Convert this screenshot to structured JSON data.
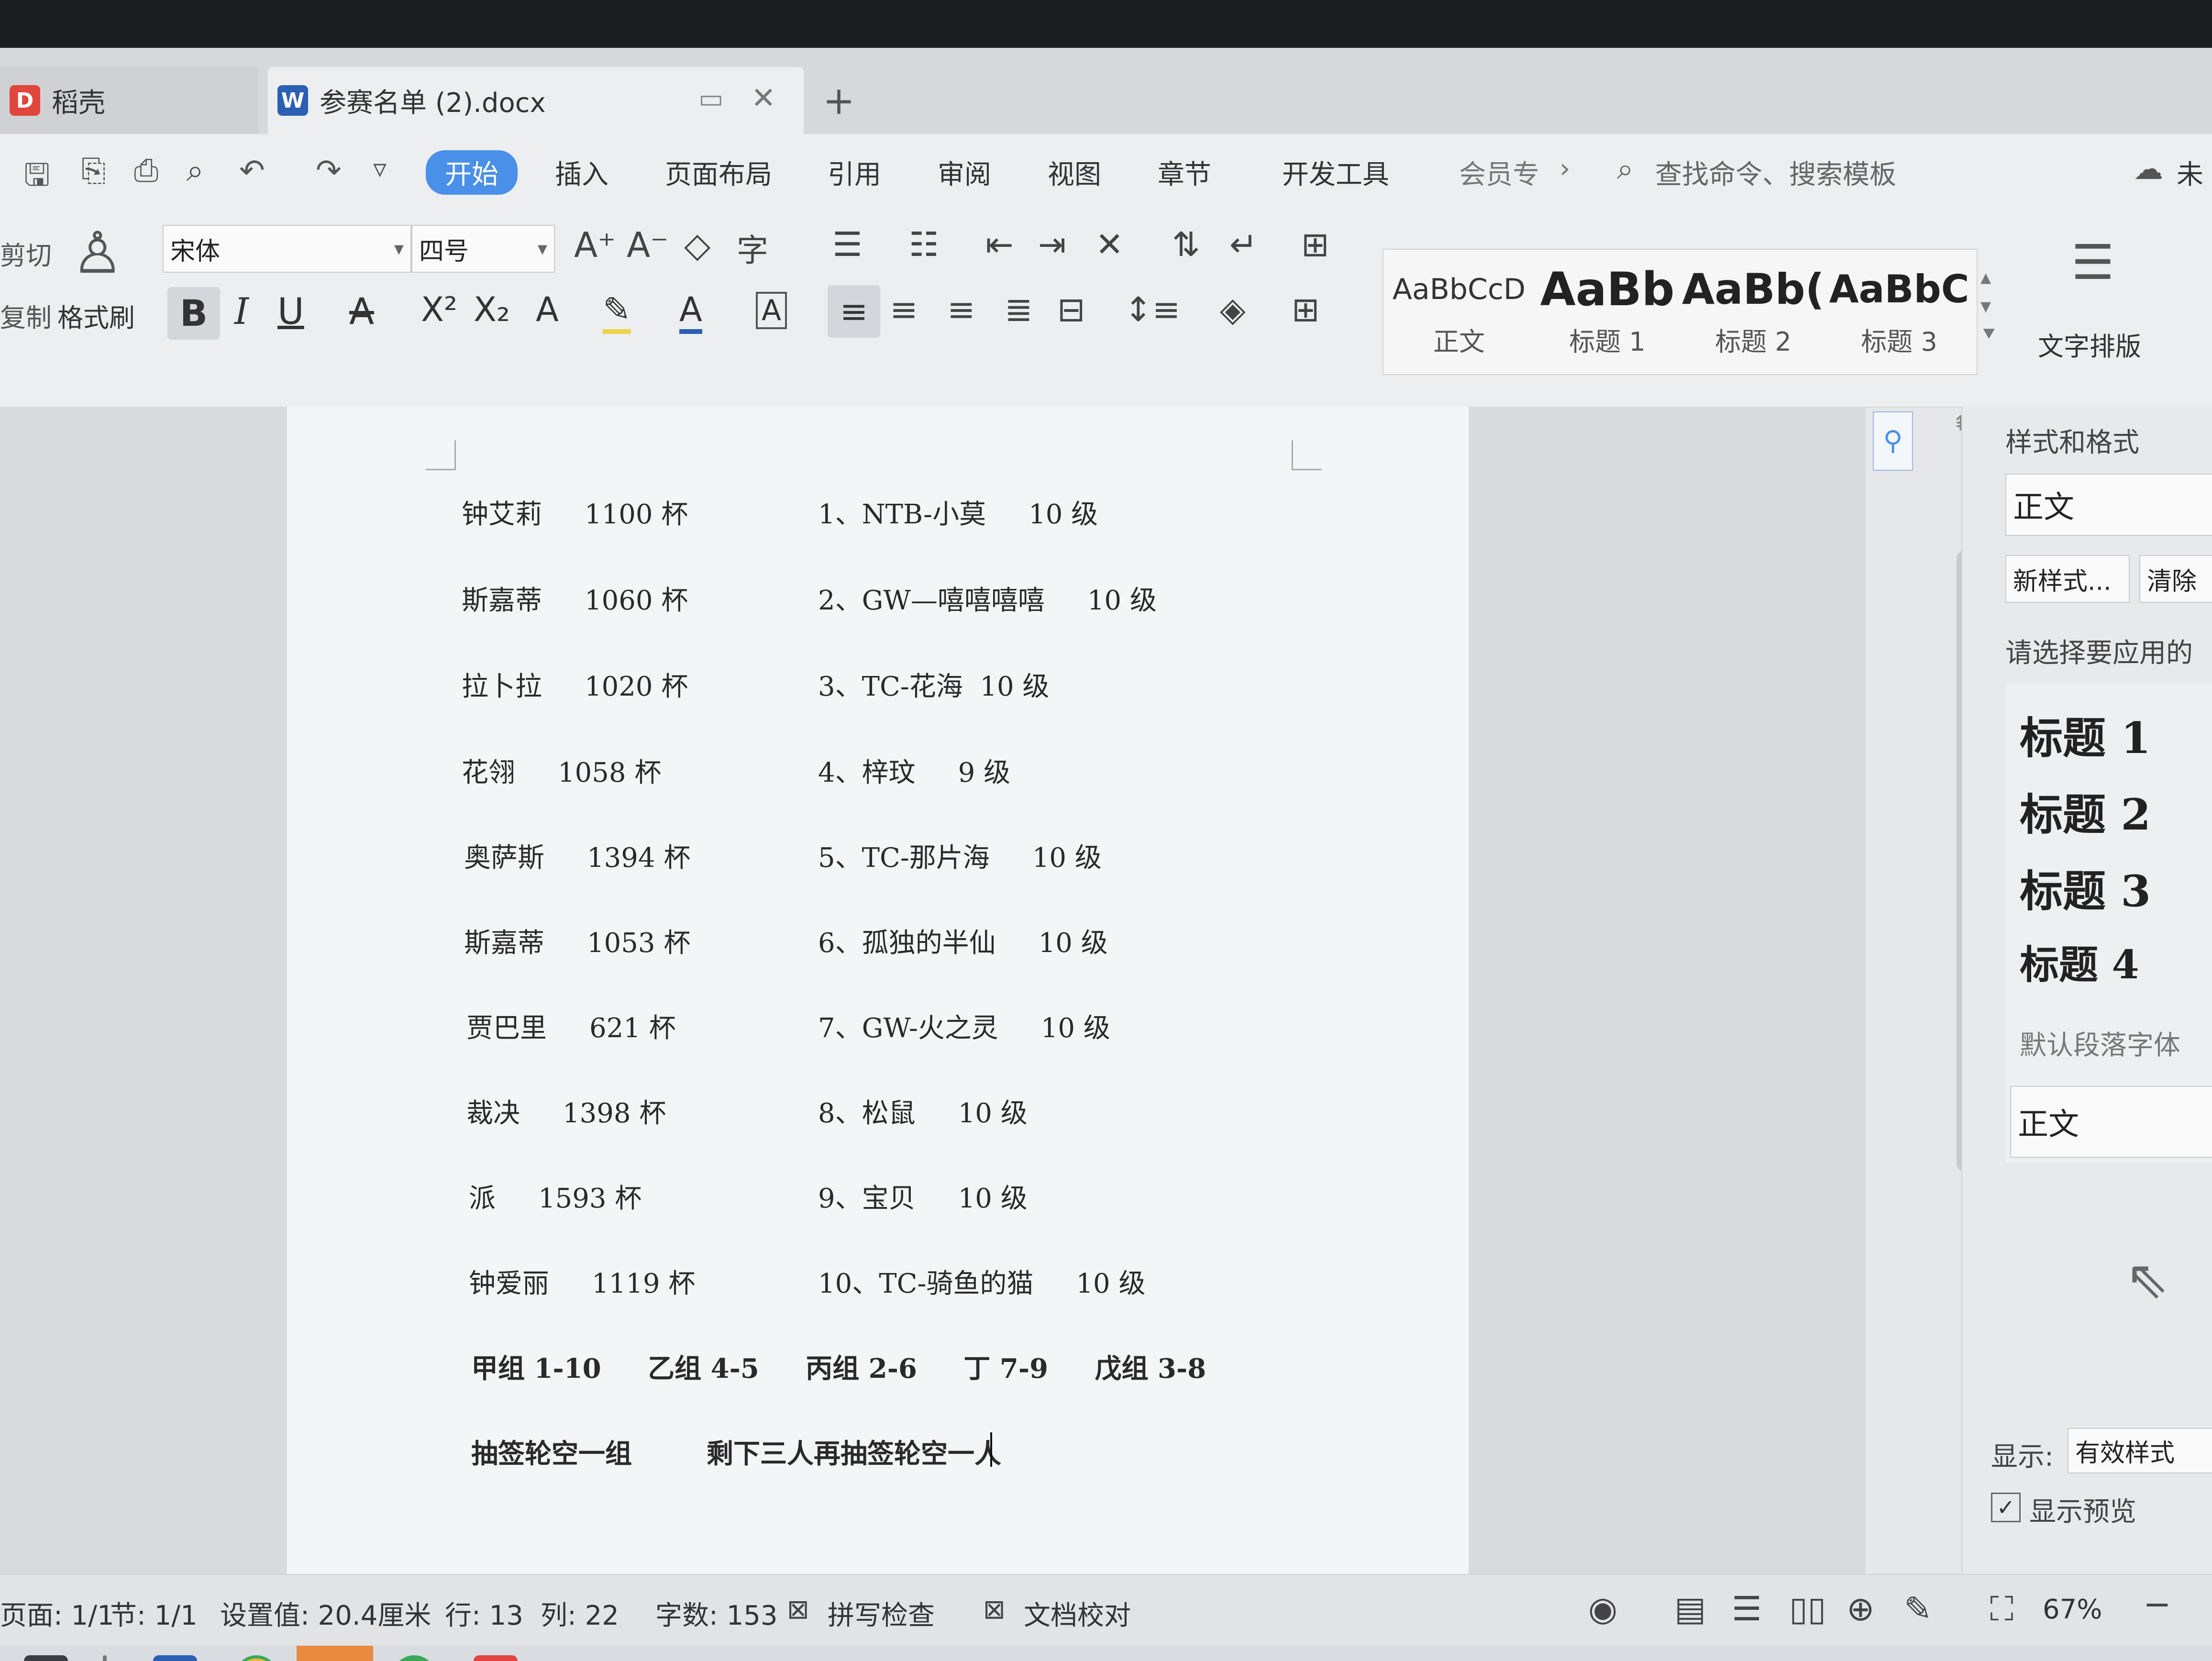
{
  "tabs": {
    "app_tab": "稻壳",
    "doc_tab": "参赛名单 (2).docx",
    "new_tab": "+"
  },
  "menu": {
    "items": [
      "开始",
      "插入",
      "页面布局",
      "引用",
      "审阅",
      "视图",
      "章节",
      "开发工具",
      "会员专"
    ],
    "more": "›",
    "search_placeholder": "查找命令、搜索模板",
    "cloud": "未"
  },
  "ribbon": {
    "cut": "剪切",
    "copy": "复制",
    "format_painter": "格式刷",
    "font_name": "宋体",
    "font_size": "四号",
    "styles": [
      {
        "preview": "AaBbCcD",
        "label": "正文"
      },
      {
        "preview": "AaBb",
        "label": "标题 1"
      },
      {
        "preview": "AaBb(",
        "label": "标题 2"
      },
      {
        "preview": "AaBbC",
        "label": "标题 3"
      }
    ],
    "text_layout": "文字排版"
  },
  "document": {
    "rows": [
      {
        "left": "钟艾莉     1100 杯",
        "right": "1、NTB-小莫     10 级"
      },
      {
        "left": "斯嘉蒂     1060 杯",
        "right": "2、GW—嘻嘻嘻嘻     10 级"
      },
      {
        "left": "拉卜拉     1020 杯",
        "right": "3、TC-花海  10 级"
      },
      {
        "left": "花翎     1058 杯",
        "right": "4、梓玟     9 级"
      },
      {
        "left": "奥萨斯     1394 杯",
        "right": "5、TC-那片海     10 级"
      },
      {
        "left": "斯嘉蒂     1053 杯",
        "right": "6、孤独的半仙     10 级"
      },
      {
        "left": "贾巴里     621 杯",
        "right": "7、GW-火之灵     10 级"
      },
      {
        "left": "裁决     1398 杯",
        "right": "8、松鼠     10 级"
      },
      {
        "left": "派     1593 杯",
        "right": "9、宝贝     10 级"
      },
      {
        "left": "钟爱丽     1119 杯",
        "right": "10、TC-骑鱼的猫     10 级"
      }
    ],
    "groups": "甲组 1-10     乙组 4-5     丙组 2-6     丁 7-9     戊组 3-8",
    "draw": "抽签轮空一组        剩下三人再抽签轮空一人"
  },
  "side_panel": {
    "title": "样式和格式",
    "current": "正文",
    "new_style": "新样式...",
    "clear": "清除",
    "prompt": "请选择要应用的",
    "headings": [
      "标题 1",
      "标题 2",
      "标题 3",
      "标题 4"
    ],
    "default_font": "默认段落字体",
    "body": "正文",
    "show_label": "显示:",
    "show_value": "有效样式",
    "preview_label": "显示预览"
  },
  "status": {
    "page": "页面: 1/1",
    "section": "节: 1/1",
    "setting": "设置值: 20.4厘米",
    "row": "行: 13",
    "col": "列: 22",
    "words": "字数: 153",
    "spell": "拼写检查",
    "proof": "文档校对",
    "zoom": "67%"
  },
  "colors": {
    "accent": "#4a8fe8",
    "wps_red": "#e0463c",
    "word_blue": "#2b5fb3"
  }
}
